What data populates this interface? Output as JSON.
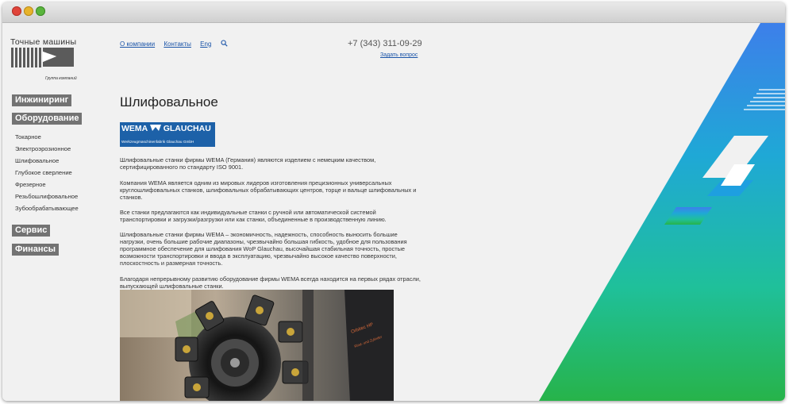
{
  "header": {
    "logo_title": "Точные машины",
    "logo_subtitle": "Группа компаний",
    "nav": [
      "О компании",
      "Контакты",
      "Eng"
    ],
    "phone": "+7 (343) 311-09-29",
    "ask_link": "Задать вопрос",
    "search_icon": "search-icon"
  },
  "sidebar": {
    "sections": [
      "Инжиниринг",
      "Оборудование",
      "Сервис",
      "Финансы"
    ],
    "items": [
      "Токарное",
      "Электроэрозионное",
      "Шлифовальное",
      "Глубокое сверление",
      "Фрезерное",
      "Резьбошлифовальное",
      "Зубообрабатывающее"
    ]
  },
  "main": {
    "title": "Шлифовальное",
    "logo_brand_left": "WEMA",
    "logo_brand_right": "GLAUCHAU",
    "logo_tagline": "Werkzeugmaschinenfabrik Glauchau GmbH",
    "paragraphs": [
      "Шлифовальные станки фирмы WEMA (Германия) являются изделием с немецким качеством, сертифицированного по стандарту ISO 9001.",
      "Компания WEMA является одним из мировых лидеров изготовления прецизионных универсальных круглошлифовальных станков, шлифовальных обрабатывающих центров, торце и вальце шлифовальных и станков.",
      "Все станки предлагаются как индивидуальные станки с ручной или автоматической системой транспортировки и загрузки/разгрузки или как станки, объединенные в производственную линию.",
      "Шлифовальные станки фирмы WEMA – экономичность, надежность, способность выносить большие нагрузки, очень большие рабочие диапазоны, чрезвычайно большая гибкость, удобное для пользования программное обеспечение для шлифования WoP Glauchau, высочайшая стабильная точность, простые возможности транспортировки и ввода в эксплуатацию, чрезвычайно высокое качество поверхности, плоскостность и размерная точность.",
      "Благодаря непрерывному развитию оборудование фирмы WEMA всегда находится на первых рядах отрасли, выпускающей шлифовальные станки."
    ],
    "photo_caption": "Orbitec HP",
    "photo_caption_small": "Rind- und Zylinder"
  },
  "colors": {
    "accent_blue": "#1d61a8",
    "link": "#1a54a8",
    "sidebar_header_bg": "#737373",
    "gradient_top": "#3d7fea",
    "gradient_bottom": "#27b34a"
  }
}
